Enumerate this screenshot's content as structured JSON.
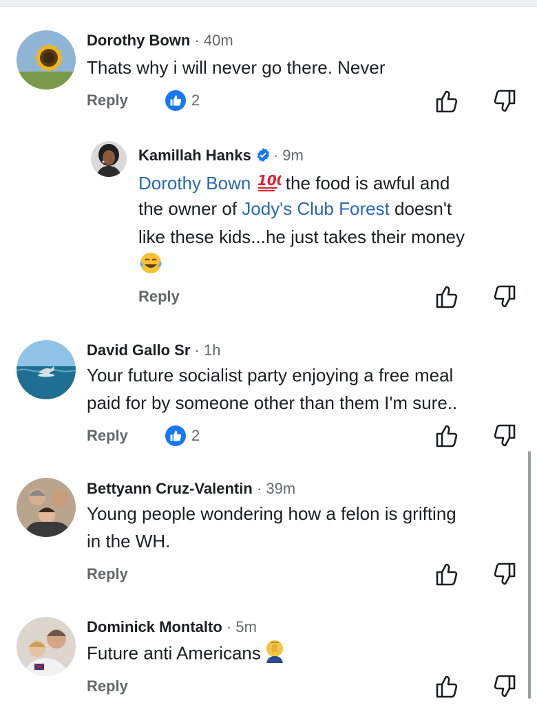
{
  "comments": [
    {
      "author": "Dorothy Bown",
      "time": "· 40m",
      "text": "Thats why i will never go there. Never",
      "reply_label": "Reply",
      "likes": "2",
      "avatar": "sunflower-avatar"
    },
    {
      "author": "Kamillah Hanks",
      "time": "· 9m",
      "verified": true,
      "mention_1": "Dorothy Bown",
      "text_1": "the food is awful and",
      "text_2_pre": "the owner of ",
      "mention_2": "Jody's Club Forest",
      "text_2_post": " doesn't",
      "text_3": "like these kids...he just takes their money",
      "emoji_1": "hundred-points-emoji",
      "emoji_2": "tears-of-joy-emoji",
      "reply_label": "Reply",
      "avatar": "portrait-avatar"
    },
    {
      "author": "David Gallo Sr",
      "time": "· 1h",
      "text_1": "Your future socialist party enjoying a free meal",
      "text_2": "paid for by someone other than them I'm sure..",
      "reply_label": "Reply",
      "likes": "2",
      "avatar": "dolphin-sea-avatar"
    },
    {
      "author": "Bettyann Cruz-Valentin",
      "time": "· 39m",
      "text_1": "Young people wondering how a felon is grifting",
      "text_2": "in the WH.",
      "reply_label": "Reply",
      "avatar": "family-photo-avatar"
    },
    {
      "author": "Dominick Montalto",
      "time": "· 5m",
      "text": "Future anti Americans",
      "emoji": "face-palm-emoji",
      "reply_label": "Reply",
      "avatar": "couple-photo-avatar"
    }
  ],
  "colors": {
    "like_blue": "#1877f2",
    "mention_blue": "#2a67b5",
    "meta_gray": "#65676b"
  },
  "icons": {
    "upvote": "thumbs-up-outline-icon",
    "downvote": "thumbs-down-outline-icon"
  }
}
